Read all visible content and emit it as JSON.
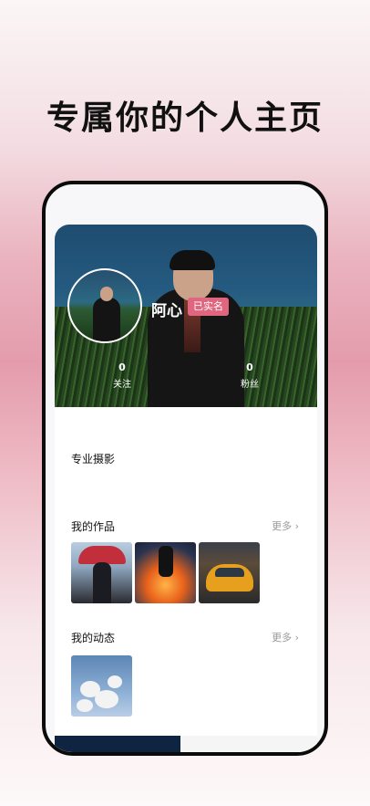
{
  "headline": "专属你的个人主页",
  "profile": {
    "name": "阿心",
    "verified_badge": "已实名",
    "following_count": "0",
    "following_label": "关注",
    "followers_count": "0",
    "followers_label": "粉丝",
    "description": "专业摄影"
  },
  "works": {
    "title": "我的作品",
    "more_label": "更多",
    "more_icon": "chevron-right-icon",
    "items": [
      "photo-umbrella-street",
      "photo-fire-stage",
      "photo-yellow-car"
    ]
  },
  "moments": {
    "title": "我的动态",
    "more_label": "更多",
    "more_icon": "chevron-right-icon",
    "items": [
      "photo-blossom-tree"
    ]
  },
  "colors": {
    "badge": "#e0657f",
    "phone_frame": "#0b0b0b",
    "page_gradient_pink": "#e49cad"
  }
}
